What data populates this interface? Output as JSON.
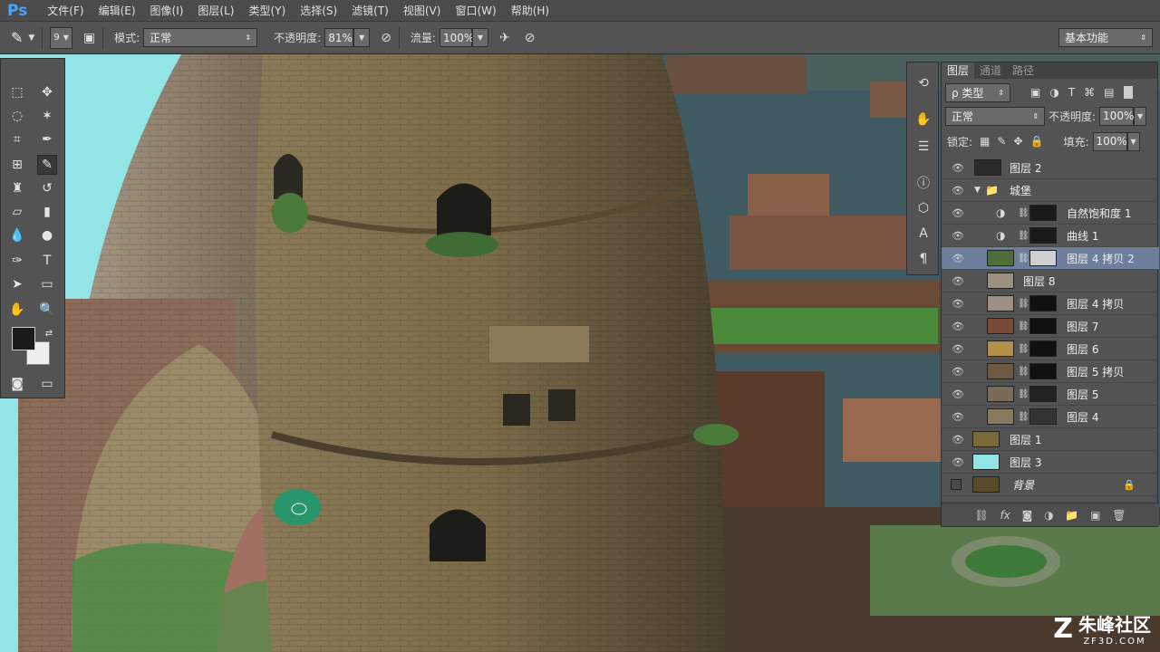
{
  "app": {
    "logo": "Ps"
  },
  "menu": [
    "文件(F)",
    "编辑(E)",
    "图像(I)",
    "图层(L)",
    "类型(Y)",
    "选择(S)",
    "滤镜(T)",
    "视图(V)",
    "窗口(W)",
    "帮助(H)"
  ],
  "options": {
    "brush_size": "9",
    "mode_label": "模式:",
    "mode_value": "正常",
    "opacity_label": "不透明度:",
    "opacity_value": "81%",
    "flow_label": "流量:",
    "flow_value": "100%",
    "workspace": "基本功能"
  },
  "layers_panel": {
    "tabs": [
      "图层",
      "通道",
      "路径"
    ],
    "filter_kind": "ρ 类型",
    "blend_mode": "正常",
    "opacity_label": "不透明度:",
    "opacity_value": "100%",
    "lock_label": "锁定:",
    "fill_label": "填充:",
    "fill_value": "100%",
    "layers": [
      {
        "name": "图层 2",
        "visible": true,
        "thumb": "#2a2a2a"
      },
      {
        "name": "城堡",
        "visible": true,
        "group": true
      },
      {
        "name": "自然饱和度 1",
        "visible": true,
        "adjustment": true
      },
      {
        "name": "曲线 1",
        "visible": true,
        "adjustment": true
      },
      {
        "name": "图层 4 拷贝 2",
        "visible": true,
        "selected": true,
        "thumb": "#4f6e3a"
      },
      {
        "name": "图层 8",
        "visible": true,
        "thumb": "#9a8f80"
      },
      {
        "name": "图层 4 拷贝",
        "visible": true,
        "thumb": "#9a8f80"
      },
      {
        "name": "图层 7",
        "visible": true,
        "thumb": "#7a4a38"
      },
      {
        "name": "图层 6",
        "visible": true,
        "thumb": "#b38d4a"
      },
      {
        "name": "图层 5 拷贝",
        "visible": true,
        "thumb": "#6e5a40"
      },
      {
        "name": "图层 5",
        "visible": true,
        "thumb": "#7a6a5a"
      },
      {
        "name": "图层 4",
        "visible": true,
        "thumb": "#8a7a60"
      },
      {
        "name": "图层 1",
        "visible": true,
        "thumb": "#7a6a3a"
      },
      {
        "name": "图层 3",
        "visible": true,
        "thumb": "#93e5e5"
      },
      {
        "name": "背景",
        "visible": false,
        "thumb": "#5a4a2a"
      }
    ]
  },
  "watermark": {
    "brand": "朱峰社区",
    "url": "ZF3D.COM"
  },
  "colors": {
    "canvas_bg": "#93e5e5",
    "panel": "#535353",
    "selection": "#6d7f9d"
  }
}
